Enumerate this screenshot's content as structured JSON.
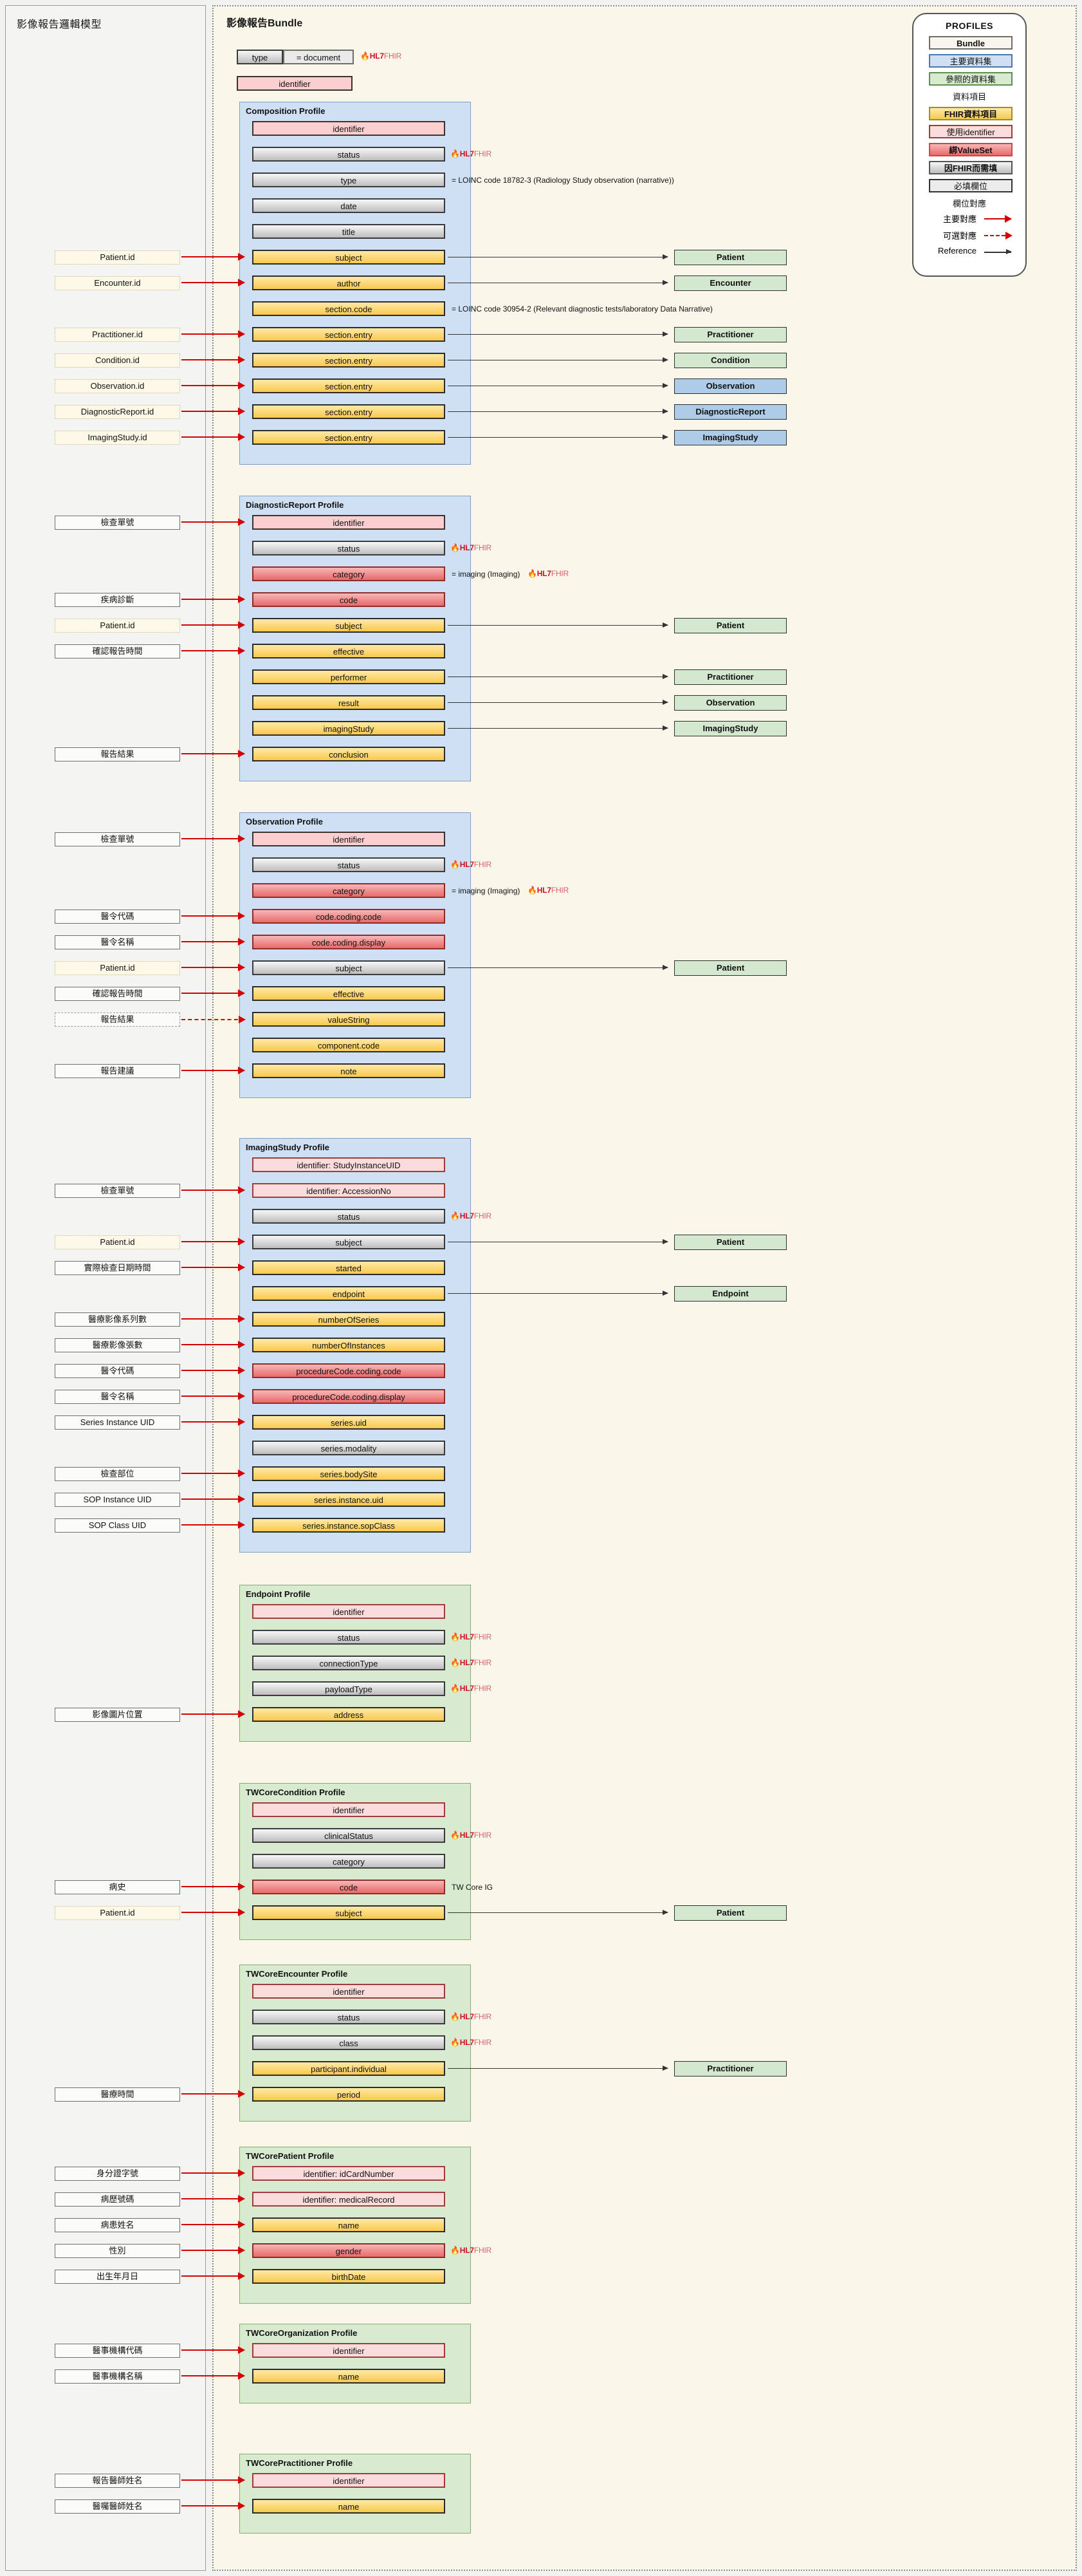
{
  "left_panel": {
    "title": "影像報告邏輯模型"
  },
  "bundle_panel": {
    "title": "影像報告Bundle",
    "type_label": "type",
    "type_value": "= document",
    "identifier": "identifier",
    "hl7_mark": "HL7",
    "fhir_mark": "FHIR"
  },
  "legend": {
    "title": "PROFILES",
    "items": [
      {
        "label": "Bundle",
        "kind": "bundle"
      },
      {
        "label": "主要資料集",
        "kind": "primary"
      },
      {
        "label": "參照的資料集",
        "kind": "referenced"
      },
      {
        "label": "資料項目",
        "kind": "plaintext"
      },
      {
        "label": "FHIR資料項目",
        "kind": "fhir-item"
      },
      {
        "label": "使用identifier",
        "kind": "identifier"
      },
      {
        "label": "綁ValueSet",
        "kind": "valueset"
      },
      {
        "label": "因FHIR而需填",
        "kind": "fhir-required"
      },
      {
        "label": "必填欄位",
        "kind": "required"
      },
      {
        "label": "欄位對應",
        "kind": "plaintext"
      }
    ],
    "arrows": [
      {
        "label": "主要對應",
        "style": "solid-red"
      },
      {
        "label": "可選對應",
        "style": "dashed-red"
      },
      {
        "label": "Reference",
        "style": "solid-black"
      }
    ]
  },
  "profiles": [
    {
      "id": "composition",
      "title": "Composition Profile",
      "color": "blue",
      "rows": [
        {
          "field": "identifier",
          "style": "pink",
          "source": null,
          "note": null,
          "ref": null,
          "hl7": false
        },
        {
          "field": "status",
          "style": "grey",
          "source": null,
          "note": null,
          "ref": null,
          "hl7": true
        },
        {
          "field": "type",
          "style": "grey",
          "source": null,
          "note": "= LOINC code 18782-3 (Radiology Study observation (narrative))",
          "ref": null,
          "hl7": false
        },
        {
          "field": "date",
          "style": "grey",
          "source": null,
          "note": null,
          "ref": null,
          "hl7": false
        },
        {
          "field": "title",
          "style": "grey",
          "source": null,
          "note": null,
          "ref": null,
          "hl7": false
        },
        {
          "field": "subject",
          "style": "gold",
          "source": "Patient.id",
          "source_style": "dotted",
          "note": null,
          "ref": "Patient",
          "ref_style": "green",
          "hl7": false
        },
        {
          "field": "author",
          "style": "gold",
          "source": "Encounter.id",
          "source_style": "dotted",
          "note": null,
          "ref": "Encounter",
          "ref_style": "green",
          "hl7": false
        },
        {
          "field": "section.code",
          "style": "gold",
          "source": null,
          "note": "= LOINC code 30954-2 (Relevant diagnostic tests/laboratory Data Narrative)",
          "ref": null,
          "hl7": false
        },
        {
          "field": "section.entry",
          "style": "gold",
          "source": "Practitioner.id",
          "source_style": "dotted",
          "note": null,
          "ref": "Practitioner",
          "ref_style": "green",
          "hl7": false
        },
        {
          "field": "section.entry",
          "style": "gold",
          "source": "Condition.id",
          "source_style": "dotted",
          "note": null,
          "ref": "Condition",
          "ref_style": "green",
          "hl7": false
        },
        {
          "field": "section.entry",
          "style": "gold",
          "source": "Observation.id",
          "source_style": "dotted",
          "note": null,
          "ref": "Observation",
          "ref_style": "blue",
          "hl7": false
        },
        {
          "field": "section.entry",
          "style": "gold",
          "source": "DiagnosticReport.id",
          "source_style": "dotted",
          "note": null,
          "ref": "DiagnosticReport",
          "ref_style": "blue",
          "hl7": false
        },
        {
          "field": "section.entry",
          "style": "gold",
          "source": "ImagingStudy.id",
          "source_style": "dotted",
          "note": null,
          "ref": "ImagingStudy",
          "ref_style": "blue",
          "hl7": false
        }
      ]
    },
    {
      "id": "diagnosticreport",
      "title": "DiagnosticReport Profile",
      "color": "blue",
      "rows": [
        {
          "field": "identifier",
          "style": "pink",
          "source": "檢查單號",
          "source_style": "solid",
          "note": null,
          "ref": null,
          "hl7": false
        },
        {
          "field": "status",
          "style": "grey",
          "source": null,
          "note": null,
          "ref": null,
          "hl7": true
        },
        {
          "field": "category",
          "style": "red",
          "source": null,
          "note": "= imaging (Imaging)",
          "note_hl7": true,
          "ref": null,
          "hl7": false
        },
        {
          "field": "code",
          "style": "red",
          "source": "疾病診斷",
          "source_style": "solid",
          "note": null,
          "ref": null,
          "hl7": false
        },
        {
          "field": "subject",
          "style": "gold",
          "source": "Patient.id",
          "source_style": "dotted",
          "note": null,
          "ref": "Patient",
          "ref_style": "green",
          "hl7": false
        },
        {
          "field": "effective",
          "style": "gold",
          "source": "確認報告時間",
          "source_style": "solid",
          "note": null,
          "ref": null,
          "hl7": false
        },
        {
          "field": "performer",
          "style": "gold",
          "source": null,
          "note": null,
          "ref": "Practitioner",
          "ref_style": "green",
          "hl7": false
        },
        {
          "field": "result",
          "style": "gold",
          "source": null,
          "note": null,
          "ref": "Observation",
          "ref_style": "green",
          "hl7": false
        },
        {
          "field": "imagingStudy",
          "style": "gold",
          "source": null,
          "note": null,
          "ref": "ImagingStudy",
          "ref_style": "green",
          "hl7": false
        },
        {
          "field": "conclusion",
          "style": "gold",
          "source": "報告結果",
          "source_style": "solid",
          "note": null,
          "ref": null,
          "hl7": false
        }
      ]
    },
    {
      "id": "observation",
      "title": "Observation Profile",
      "color": "blue",
      "rows": [
        {
          "field": "identifier",
          "style": "pink",
          "source": "檢查單號",
          "source_style": "solid",
          "note": null,
          "ref": null,
          "hl7": false
        },
        {
          "field": "status",
          "style": "grey",
          "source": null,
          "note": null,
          "ref": null,
          "hl7": true
        },
        {
          "field": "category",
          "style": "red",
          "source": null,
          "note": "= imaging (Imaging)",
          "note_hl7": true,
          "ref": null,
          "hl7": false
        },
        {
          "field": "code.coding.code",
          "style": "red",
          "source": "醫令代碼",
          "source_style": "solid",
          "note": null,
          "ref": null,
          "hl7": false
        },
        {
          "field": "code.coding.display",
          "style": "red",
          "source": "醫令名稱",
          "source_style": "solid",
          "note": null,
          "ref": null,
          "hl7": false
        },
        {
          "field": "subject",
          "style": "grey",
          "source": "Patient.id",
          "source_style": "dotted",
          "note": null,
          "ref": "Patient",
          "ref_style": "green",
          "hl7": false
        },
        {
          "field": "effective",
          "style": "gold",
          "source": "確認報告時間",
          "source_style": "solid",
          "note": null,
          "ref": null,
          "hl7": false
        },
        {
          "field": "valueString",
          "style": "gold",
          "source": "報告結果",
          "source_style": "dashed",
          "note": null,
          "ref": null,
          "hl7": false
        },
        {
          "field": "component.code",
          "style": "gold",
          "source": null,
          "note": null,
          "ref": null,
          "hl7": false
        },
        {
          "field": "note",
          "style": "gold",
          "source": "報告建議",
          "source_style": "solid",
          "note": null,
          "ref": null,
          "hl7": false
        }
      ]
    },
    {
      "id": "imagingstudy",
      "title": "ImagingStudy Profile",
      "color": "blue",
      "rows": [
        {
          "field": "identifier: StudyInstanceUID",
          "style": "pinklite",
          "source": null,
          "note": null,
          "ref": null,
          "hl7": false
        },
        {
          "field": "identifier: AccessionNo",
          "style": "pinklite",
          "source": "檢查單號",
          "source_style": "solid",
          "note": null,
          "ref": null,
          "hl7": false
        },
        {
          "field": "status",
          "style": "grey",
          "source": null,
          "note": null,
          "ref": null,
          "hl7": true
        },
        {
          "field": "subject",
          "style": "grey",
          "source": "Patient.id",
          "source_style": "dotted",
          "note": null,
          "ref": "Patient",
          "ref_style": "green",
          "hl7": false
        },
        {
          "field": "started",
          "style": "gold",
          "source": "實際檢查日期時間",
          "source_style": "solid",
          "note": null,
          "ref": null,
          "hl7": false
        },
        {
          "field": "endpoint",
          "style": "gold",
          "source": null,
          "note": null,
          "ref": "Endpoint",
          "ref_style": "green",
          "hl7": false
        },
        {
          "field": "numberOfSeries",
          "style": "gold",
          "source": "醫療影像系列數",
          "source_style": "solid",
          "note": null,
          "ref": null,
          "hl7": false
        },
        {
          "field": "numberOfInstances",
          "style": "gold",
          "source": "醫療影像張數",
          "source_style": "solid",
          "note": null,
          "ref": null,
          "hl7": false
        },
        {
          "field": "procedureCode.coding.code",
          "style": "red",
          "source": "醫令代碼",
          "source_style": "solid",
          "note": null,
          "ref": null,
          "hl7": false
        },
        {
          "field": "procedureCode.coding.display",
          "style": "red",
          "source": "醫令名稱",
          "source_style": "solid",
          "note": null,
          "ref": null,
          "hl7": false
        },
        {
          "field": "series.uid",
          "style": "gold",
          "source": "Series Instance UID",
          "source_style": "solid",
          "note": null,
          "ref": null,
          "hl7": false
        },
        {
          "field": "series.modality",
          "style": "grey",
          "source": null,
          "note": null,
          "ref": null,
          "hl7": false
        },
        {
          "field": "series.bodySite",
          "style": "gold",
          "source": "檢查部位",
          "source_style": "solid",
          "note": null,
          "ref": null,
          "hl7": false
        },
        {
          "field": "series.instance.uid",
          "style": "gold",
          "source": "SOP Instance UID",
          "source_style": "solid",
          "note": null,
          "ref": null,
          "hl7": false
        },
        {
          "field": "series.instance.sopClass",
          "style": "gold",
          "source": "SOP Class UID",
          "source_style": "solid",
          "note": null,
          "ref": null,
          "hl7": false
        }
      ]
    },
    {
      "id": "endpoint",
      "title": "Endpoint Profile",
      "color": "green",
      "rows": [
        {
          "field": "identifier",
          "style": "pinklite",
          "source": null,
          "note": null,
          "ref": null,
          "hl7": false
        },
        {
          "field": "status",
          "style": "grey",
          "source": null,
          "note": null,
          "ref": null,
          "hl7": true
        },
        {
          "field": "connectionType",
          "style": "grey",
          "source": null,
          "note": null,
          "ref": null,
          "hl7": true
        },
        {
          "field": "payloadType",
          "style": "grey",
          "source": null,
          "note": null,
          "ref": null,
          "hl7": true
        },
        {
          "field": "address",
          "style": "gold",
          "source": "影像圖片位置",
          "source_style": "solid",
          "note": null,
          "ref": null,
          "hl7": false
        }
      ]
    },
    {
      "id": "twcorecondition",
      "title": "TWCoreCondition Profile",
      "color": "green",
      "rows": [
        {
          "field": "identifier",
          "style": "pinklite",
          "source": null,
          "note": null,
          "ref": null,
          "hl7": false
        },
        {
          "field": "clinicalStatus",
          "style": "grey",
          "source": null,
          "note": null,
          "ref": null,
          "hl7": true
        },
        {
          "field": "category",
          "style": "grey",
          "source": null,
          "note": null,
          "ref": null,
          "hl7": false
        },
        {
          "field": "code",
          "style": "red",
          "source": "病史",
          "source_style": "solid",
          "note": "TW Core IG",
          "ref": null,
          "hl7": false
        },
        {
          "field": "subject",
          "style": "gold",
          "source": "Patient.id",
          "source_style": "dotted",
          "note": null,
          "ref": "Patient",
          "ref_style": "green",
          "hl7": false
        }
      ]
    },
    {
      "id": "twcoreencounter",
      "title": "TWCoreEncounter Profile",
      "color": "green",
      "rows": [
        {
          "field": "identifier",
          "style": "pinklite",
          "source": null,
          "note": null,
          "ref": null,
          "hl7": false
        },
        {
          "field": "status",
          "style": "grey",
          "source": null,
          "note": null,
          "ref": null,
          "hl7": true
        },
        {
          "field": "class",
          "style": "grey",
          "source": null,
          "note": null,
          "ref": null,
          "hl7": true
        },
        {
          "field": "participant.individual",
          "style": "gold",
          "source": null,
          "note": null,
          "ref": "Practitioner",
          "ref_style": "green",
          "hl7": false
        },
        {
          "field": "period",
          "style": "gold",
          "source": "醫療時間",
          "source_style": "solid",
          "note": null,
          "ref": null,
          "hl7": false
        }
      ]
    },
    {
      "id": "twcorepatient",
      "title": "TWCorePatient Profile",
      "color": "green",
      "rows": [
        {
          "field": "identifier: idCardNumber",
          "style": "pinklite",
          "source": "身分證字號",
          "source_style": "solid",
          "note": null,
          "ref": null,
          "hl7": false
        },
        {
          "field": "identifier: medicalRecord",
          "style": "pinklite",
          "source": "病歷號碼",
          "source_style": "solid",
          "note": null,
          "ref": null,
          "hl7": false
        },
        {
          "field": "name",
          "style": "gold",
          "source": "病患姓名",
          "source_style": "solid",
          "note": null,
          "ref": null,
          "hl7": false
        },
        {
          "field": "gender",
          "style": "red",
          "source": "性別",
          "source_style": "solid",
          "note": null,
          "ref": null,
          "hl7": true
        },
        {
          "field": "birthDate",
          "style": "gold",
          "source": "出生年月日",
          "source_style": "solid",
          "note": null,
          "ref": null,
          "hl7": false
        }
      ]
    },
    {
      "id": "twcoreorganization",
      "title": "TWCoreOrganization Profile",
      "color": "green",
      "rows": [
        {
          "field": "identifier",
          "style": "pinklite",
          "source": "醫事機構代碼",
          "source_style": "solid",
          "note": null,
          "ref": null,
          "hl7": false
        },
        {
          "field": "name",
          "style": "gold",
          "source": "醫事機構名稱",
          "source_style": "solid",
          "note": null,
          "ref": null,
          "hl7": false
        }
      ]
    },
    {
      "id": "twcorepractitioner",
      "title": "TWCorePractitioner Profile",
      "color": "green",
      "rows": [
        {
          "field": "identifier",
          "style": "pinklite",
          "source": "報告醫師姓名",
          "source_style": "solid",
          "note": null,
          "ref": null,
          "hl7": false
        },
        {
          "field": "name",
          "style": "gold",
          "source": "醫囑醫師姓名",
          "source_style": "solid",
          "note": null,
          "ref": null,
          "hl7": false
        }
      ]
    }
  ]
}
